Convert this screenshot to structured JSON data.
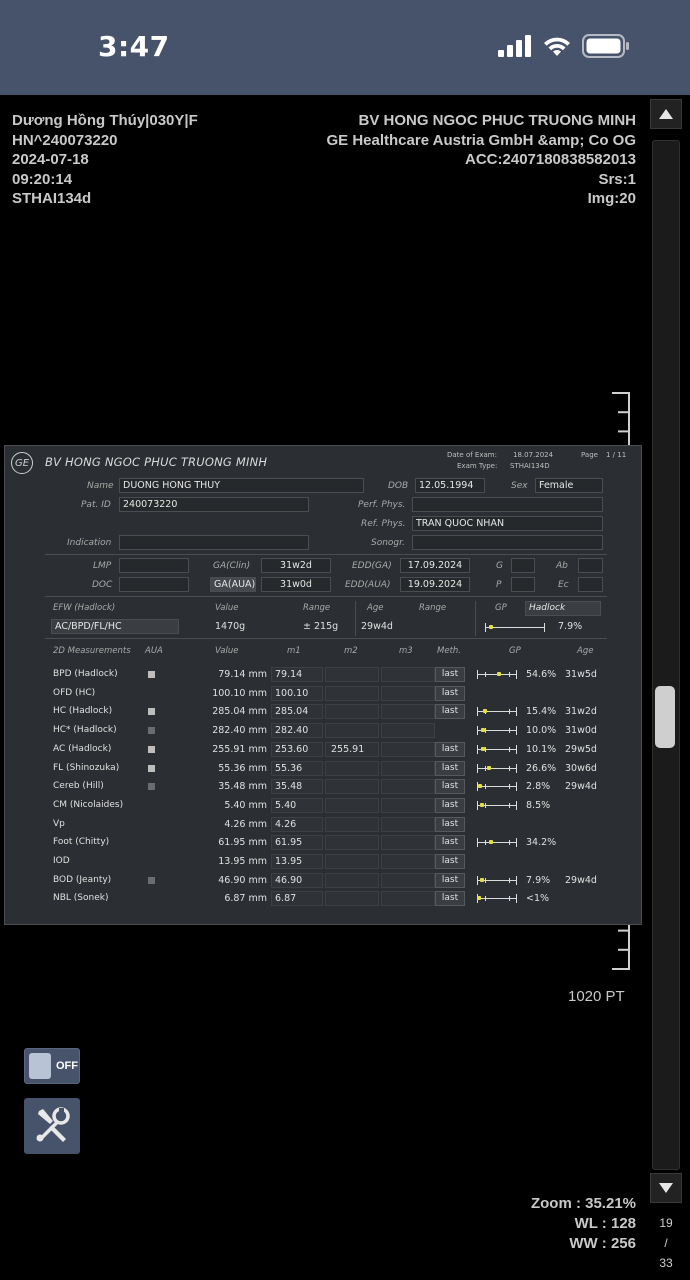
{
  "status_bar": {
    "time": "3:47"
  },
  "overlay": {
    "left": [
      "Dương Hồng Thúy|030Y|F",
      "HN^240073220",
      "2024-07-18",
      "09:20:14",
      "STHAI134d"
    ],
    "right": [
      "BV HONG NGOC PHUC TRUONG MINH",
      "GE Healthcare Austria GmbH &amp; Co OG",
      "ACC:2407180838582013",
      "Srs:1",
      "Img:20"
    ],
    "pt": "1020 PT",
    "zoom": "Zoom : 35.21%",
    "wl": "WL : 128",
    "ww": "WW : 256"
  },
  "viewer": {
    "toggle_label": "OFF",
    "image_counter": {
      "current": "19",
      "sep": "/",
      "total": "33"
    },
    "scroll_position": 0.53
  },
  "report": {
    "logo": "GE",
    "hospital": "BV HONG NGOC PHUC TRUONG MINH",
    "date_of_exam_label": "Date of Exam:",
    "date_of_exam": "18.07.2024",
    "exam_type_label": "Exam Type:",
    "exam_type": "STHAI134D",
    "page_label": "Page",
    "page": "1 / 11",
    "patient": {
      "name_label": "Name",
      "name": "DUONG HONG THUY",
      "dob_label": "DOB",
      "dob": "12.05.1994",
      "sex_label": "Sex",
      "sex": "Female",
      "pat_id_label": "Pat. ID",
      "pat_id": "240073220",
      "perf_phys_label": "Perf. Phys.",
      "perf_phys": "",
      "ref_phys_label": "Ref. Phys.",
      "ref_phys": "TRAN QUOC NHAN",
      "indication_label": "Indication",
      "indication": "",
      "sonogr_label": "Sonogr.",
      "sonogr": ""
    },
    "dates": {
      "lmp_label": "LMP",
      "lmp": "",
      "doc_label": "DOC",
      "doc": "",
      "ga_clin_label": "GA(Clin)",
      "ga_clin": "31w2d",
      "ga_aua_label": "GA(AUA)",
      "ga_aua": "31w0d",
      "edd_ga_label": "EDD(GA)",
      "edd_ga": "17.09.2024",
      "edd_aua_label": "EDD(AUA)",
      "edd_aua": "19.09.2024",
      "g_label": "G",
      "g": "",
      "p_label": "P",
      "p": "",
      "ab_label": "Ab",
      "ab": "",
      "ec_label": "Ec",
      "ec": ""
    },
    "efw": {
      "headers": {
        "name": "EFW (Hadlock)",
        "value": "Value",
        "range": "Range",
        "age": "Age",
        "age_range": "Range",
        "gp": "GP"
      },
      "gp_method": "Hadlock",
      "formula": "AC/BPD/FL/HC",
      "value": "1470g",
      "range": "± 215g",
      "age": "29w4d",
      "gp_value": "7.9%",
      "gp_fraction": 0.079
    },
    "table_headers": {
      "name": "2D Measurements",
      "aua": "AUA",
      "value": "Value",
      "m1": "m1",
      "m2": "m2",
      "m3": "m3",
      "meth": "Meth.",
      "gp": "GP",
      "age": "Age"
    },
    "rows": [
      {
        "name": "BPD (Hadlock)",
        "aua": "on",
        "value": "79.14 mm",
        "m1": "79.14",
        "m2": "",
        "m3": "",
        "meth": "last",
        "gp": "54.6%",
        "age": "31w5d",
        "gp_fraction": 0.546,
        "bar": true
      },
      {
        "name": "OFD (HC)",
        "aua": "",
        "value": "100.10 mm",
        "m1": "100.10",
        "m2": "",
        "m3": "",
        "meth": "last",
        "gp": "",
        "age": "",
        "gp_fraction": null,
        "bar": false
      },
      {
        "name": "HC (Hadlock)",
        "aua": "on",
        "value": "285.04 mm",
        "m1": "285.04",
        "m2": "",
        "m3": "",
        "meth": "last",
        "gp": "15.4%",
        "age": "31w2d",
        "gp_fraction": 0.154,
        "bar": true
      },
      {
        "name": "HC* (Hadlock)",
        "aua": "off",
        "value": "282.40 mm",
        "m1": "282.40",
        "m2": "",
        "m3": "",
        "meth": "",
        "gp": "10.0%",
        "age": "31w0d",
        "gp_fraction": 0.1,
        "bar": true
      },
      {
        "name": "AC (Hadlock)",
        "aua": "on",
        "value": "255.91 mm",
        "m1": "253.60",
        "m2": "255.91",
        "m3": "",
        "meth": "last",
        "gp": "10.1%",
        "age": "29w5d",
        "gp_fraction": 0.101,
        "bar": true
      },
      {
        "name": "FL (Shinozuka)",
        "aua": "on",
        "value": "55.36 mm",
        "m1": "55.36",
        "m2": "",
        "m3": "",
        "meth": "last",
        "gp": "26.6%",
        "age": "30w6d",
        "gp_fraction": 0.266,
        "bar": true
      },
      {
        "name": "Cereb (Hill)",
        "aua": "off",
        "value": "35.48 mm",
        "m1": "35.48",
        "m2": "",
        "m3": "",
        "meth": "last",
        "gp": "2.8%",
        "age": "29w4d",
        "gp_fraction": 0.028,
        "bar": true
      },
      {
        "name": "CM (Nicolaides)",
        "aua": "",
        "value": "5.40 mm",
        "m1": "5.40",
        "m2": "",
        "m3": "",
        "meth": "last",
        "gp": "8.5%",
        "age": "",
        "gp_fraction": 0.085,
        "bar": true
      },
      {
        "name": "Vp",
        "aua": "",
        "value": "4.26 mm",
        "m1": "4.26",
        "m2": "",
        "m3": "",
        "meth": "last",
        "gp": "",
        "age": "",
        "gp_fraction": null,
        "bar": false
      },
      {
        "name": "Foot (Chitty)",
        "aua": "",
        "value": "61.95 mm",
        "m1": "61.95",
        "m2": "",
        "m3": "",
        "meth": "last",
        "gp": "34.2%",
        "age": "",
        "gp_fraction": 0.342,
        "bar": true
      },
      {
        "name": "IOD",
        "aua": "",
        "value": "13.95 mm",
        "m1": "13.95",
        "m2": "",
        "m3": "",
        "meth": "last",
        "gp": "",
        "age": "",
        "gp_fraction": null,
        "bar": false
      },
      {
        "name": "BOD (Jeanty)",
        "aua": "off",
        "value": "46.90 mm",
        "m1": "46.90",
        "m2": "",
        "m3": "",
        "meth": "last",
        "gp": "7.9%",
        "age": "29w4d",
        "gp_fraction": 0.079,
        "bar": true
      },
      {
        "name": "NBL (Sonek)",
        "aua": "",
        "value": "6.87 mm",
        "m1": "6.87",
        "m2": "",
        "m3": "",
        "meth": "last",
        "gp": "<1%",
        "age": "",
        "gp_fraction": 0.0,
        "bar": true
      }
    ],
    "colors": {
      "panel_bg": "#2b2e32",
      "gp_marker": "#e6df3a",
      "viewer_accent": "#46536b"
    }
  }
}
